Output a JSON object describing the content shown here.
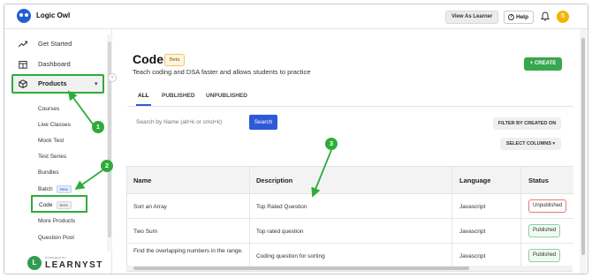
{
  "app": {
    "brand": "Logic Owl"
  },
  "header": {
    "view_as_learner": "View As Learner",
    "help": "Help",
    "avatar_initial": "S"
  },
  "sidebar": {
    "main_items": [
      {
        "label": "Get Started",
        "icon": "trend-up-icon"
      },
      {
        "label": "Dashboard",
        "icon": "calendar-icon"
      },
      {
        "label": "Products",
        "icon": "box-icon"
      }
    ],
    "sub_items": [
      {
        "label": "Courses"
      },
      {
        "label": "Live Classes"
      },
      {
        "label": "Mock Test"
      },
      {
        "label": "Test Series"
      },
      {
        "label": "Bundles"
      },
      {
        "label": "Batch",
        "badge": "New"
      },
      {
        "label": "Code",
        "badge": "Beta"
      },
      {
        "label": "More Products"
      },
      {
        "label": "Question Pool"
      }
    ],
    "footer": {
      "powered_by": "POWERED BY",
      "word": "LEARNYST",
      "mark": "L"
    }
  },
  "page": {
    "title": "Code",
    "title_badge": "Beta",
    "subtitle": "Teach coding and DSA faster and allows students to practice",
    "create_label": "+ CREATE",
    "tabs": [
      {
        "label": "ALL"
      },
      {
        "label": "PUBLISHED"
      },
      {
        "label": "UNPUBLISHED"
      }
    ],
    "search_placeholder": "Search by Name (alt+k or cmd+k)",
    "search_button": "Search",
    "filter_label": "FILTER BY CREATED ON",
    "select_columns_label": "SELECT COLUMNS"
  },
  "table": {
    "headers": [
      "Name",
      "Description",
      "Language",
      "Status"
    ],
    "rows": [
      {
        "name": "Sort an Array",
        "description": "Top Rated Question",
        "language": "Javascript",
        "status": "Unpublished"
      },
      {
        "name": "Two Sum",
        "description": "Top rated question",
        "language": "Javascript",
        "status": "Published"
      },
      {
        "name": "Find the overlapping numbers in the range.",
        "description": "Coding question for sorting",
        "language": "Javascript",
        "status": "Published"
      }
    ]
  },
  "annotations": {
    "numbers": [
      "1",
      "2",
      "3"
    ],
    "color": "#2fab3a"
  },
  "colors": {
    "primary": "#2e59d9",
    "create": "#38a84f",
    "highlight": "#2fab3a",
    "unpublished_border": "#e27a7a",
    "published_border": "#8fcf9b"
  }
}
